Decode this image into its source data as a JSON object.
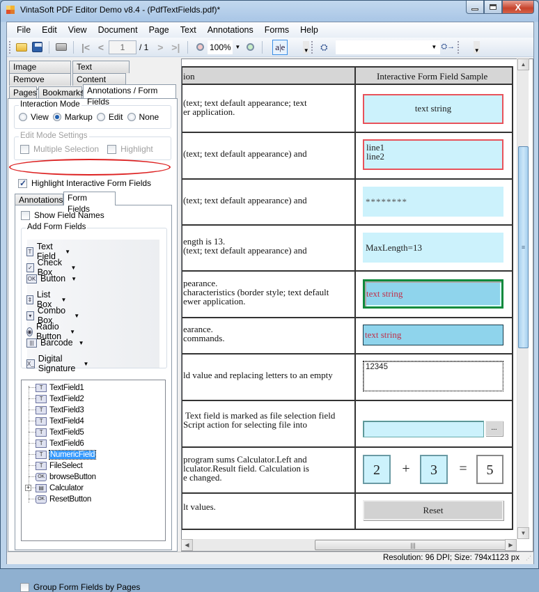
{
  "window": {
    "title": "VintaSoft PDF Editor Demo v8.4 -  (PdfTextFields.pdf)*",
    "min_label": "—",
    "max_label": "□",
    "close_label": "X"
  },
  "menu": [
    "File",
    "Edit",
    "View",
    "Document",
    "Page",
    "Text",
    "Annotations",
    "Forms",
    "Help"
  ],
  "toolbar": {
    "page_current": "1",
    "page_total": "/ 1",
    "zoom": "100%",
    "text_tool_label": "a|e",
    "search_value": ""
  },
  "left_tabs": {
    "row1": [
      "Image Extraction",
      "Text Extraction"
    ],
    "row2": [
      "Remove Content",
      "Content Editor"
    ],
    "row3": [
      "Pages",
      "Bookmarks",
      "Annotations / Form Fields"
    ],
    "active": "Annotations / Form Fields"
  },
  "interaction_mode": {
    "title": "Interaction Mode",
    "options": [
      "View",
      "Markup",
      "Edit",
      "None"
    ],
    "selected": "Markup"
  },
  "edit_mode": {
    "title": "Edit Mode Settings",
    "multiple_selection": "Multiple Selection",
    "highlight": "Highlight"
  },
  "highlight_fields": {
    "label": "Highlight Interactive Form  Fields",
    "checked": true
  },
  "sub_tabs": {
    "items": [
      "Annotations",
      "Form Fields"
    ],
    "active": "Form Fields"
  },
  "show_field_names": {
    "label": "Show Field Names",
    "checked": false
  },
  "add_form_fields": {
    "title": "Add Form Fields",
    "items": [
      {
        "label": "Text Field",
        "icon": "text-field-icon"
      },
      {
        "label": "Check Box",
        "icon": "check-box-icon"
      },
      {
        "label": "Button",
        "icon": "ok-button-icon"
      },
      {
        "label": "List Box",
        "icon": "list-box-icon"
      },
      {
        "label": "Combo Box",
        "icon": "combo-box-icon"
      },
      {
        "label": "Radio Button",
        "icon": "radio-button-icon"
      },
      {
        "label": "Barcode",
        "icon": "barcode-icon"
      },
      {
        "label": "Digital Signature",
        "icon": "signature-icon"
      }
    ]
  },
  "field_tree": {
    "items": [
      {
        "label": "TextField1",
        "icon": "T"
      },
      {
        "label": "TextField2",
        "icon": "T"
      },
      {
        "label": "TextField3",
        "icon": "T"
      },
      {
        "label": "TextField4",
        "icon": "T"
      },
      {
        "label": "TextField5",
        "icon": "T"
      },
      {
        "label": "TextField6",
        "icon": "T"
      },
      {
        "label": "NumericField",
        "icon": "T",
        "selected": true
      },
      {
        "label": "FileSelect",
        "icon": "T"
      },
      {
        "label": "browseButton",
        "icon": "OK"
      },
      {
        "label": "Calculator",
        "icon": "group",
        "expandable": true
      },
      {
        "label": "ResetButton",
        "icon": "OK"
      }
    ]
  },
  "group_by_pages": {
    "label": "Group Form Fields by Pages",
    "checked": false
  },
  "document": {
    "header_left": "ion",
    "header_right": "Interactive Form Field Sample",
    "rows": [
      {
        "desc": "(text; text default appearance; text\ner application.",
        "sample": "text string"
      },
      {
        "desc": "(text; text default appearance) and",
        "sample": "line1\nline2"
      },
      {
        "desc": "(text; text default appearance) and",
        "sample": "********"
      },
      {
        "desc": "ength is 13.\n(text; text default appearance) and",
        "sample": "MaxLength=13"
      },
      {
        "desc": "pearance.\ncharacteristics (border style; text default\newer application.",
        "sample": "text string"
      },
      {
        "desc": "earance.\ncommands.",
        "sample": "text string"
      },
      {
        "desc": "ld value and replacing letters to an empty",
        "sample": "12345"
      },
      {
        "desc": " Text field is marked as file selection field\nScript action for selecting file into",
        "sample": "",
        "browse_label": "..."
      },
      {
        "desc": "program sums Calculator.Left and\nlculator.Result field. Calculation is\ne changed.",
        "left": "2",
        "op": "+",
        "right": "3",
        "eq": "=",
        "result": "5"
      },
      {
        "desc": "lt values.",
        "sample": "Reset"
      }
    ]
  },
  "status": {
    "text": "Resolution: 96 DPI; Size: 794x1123 px"
  },
  "colors": {
    "field_bg": "#ccf2fc",
    "red_border": "#e8525a",
    "green_border": "#0f8a3c",
    "selected": "#3399ff"
  }
}
